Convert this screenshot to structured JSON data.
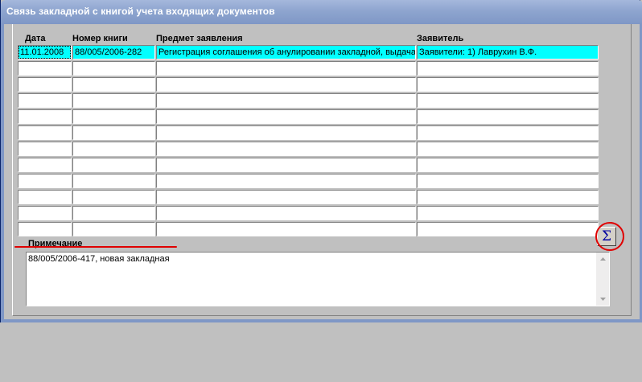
{
  "window": {
    "title": "Связь закладной с книгой учета входящих документов"
  },
  "table": {
    "columns": [
      "Дата",
      "Номер книги",
      "Предмет заявления",
      "Заявитель"
    ],
    "rows": [
      [
        "11.01.2008",
        "88/005/2006-282",
        "Регистрация соглашения об анулировании закладной, выдача",
        "Заявители:  1) Лаврухин В.Ф."
      ],
      [
        "",
        "",
        "",
        ""
      ],
      [
        "",
        "",
        "",
        ""
      ],
      [
        "",
        "",
        "",
        ""
      ],
      [
        "",
        "",
        "",
        ""
      ],
      [
        "",
        "",
        "",
        ""
      ],
      [
        "",
        "",
        "",
        ""
      ],
      [
        "",
        "",
        "",
        ""
      ],
      [
        "",
        "",
        "",
        ""
      ],
      [
        "",
        "",
        "",
        ""
      ],
      [
        "",
        "",
        "",
        ""
      ],
      [
        "",
        "",
        "",
        ""
      ]
    ],
    "selected_row_color": "#00ffff"
  },
  "note": {
    "label": "Примечание",
    "value": "88/005/2006-417, новая закладная"
  },
  "sum_button": {
    "symbol": "Σ"
  },
  "annotations": {
    "highlight_color": "#e00000"
  }
}
